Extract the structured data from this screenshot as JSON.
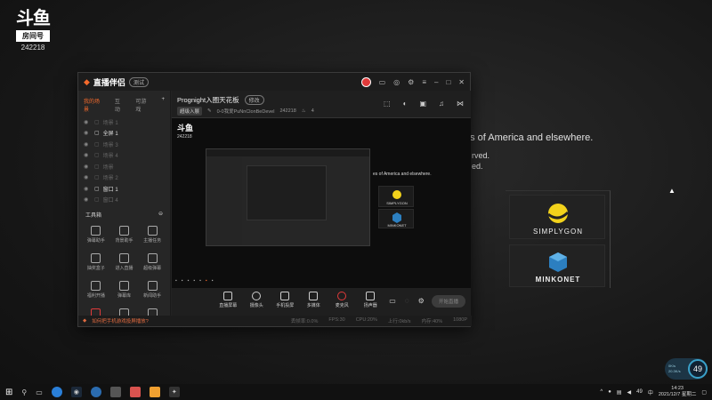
{
  "watermark": {
    "logo": "斗鱼",
    "room_label": "房间号",
    "room_id": "242218"
  },
  "bg": {
    "line1": "es of America and elsewhere.",
    "line2": "rved.",
    "line3": "ed.",
    "brand1": "SIMPLYGON",
    "brand2": "MINKONET"
  },
  "app": {
    "brand": "直播伴侣",
    "version_pill": "测试",
    "side_tabs": [
      "我的场景",
      "互动",
      "可游戏"
    ],
    "scenes": [
      {
        "label": "场景 1",
        "hi": false
      },
      {
        "label": "全屏 1",
        "hi": true
      },
      {
        "label": "场景 3",
        "hi": false
      },
      {
        "label": "场景 4",
        "hi": false
      },
      {
        "label": "场景",
        "hi": false
      },
      {
        "label": "场景 2",
        "hi": false
      },
      {
        "label": "窗口 1",
        "hi": true
      },
      {
        "label": "窗口 4",
        "hi": false
      }
    ],
    "tools_title": "工具箱",
    "tools": [
      "弹幕助手",
      "背景助手",
      "主播任务",
      "抽奖盒子",
      "进入直播",
      "超级弹幕",
      "福利开播",
      "弹幕库",
      "新闻助手",
      "",
      "",
      ""
    ],
    "room_title": "Prognight入圈天花板",
    "room_tag": "修改",
    "room_meta_tag": "超级入展",
    "room_meta_text": "0-0我爱PuNnClonBeDevel",
    "room_meta_id": "242218",
    "room_meta_count": "4",
    "preview_wm": "斗鱼",
    "preview_wm_id": "242218",
    "preview_text": "es of America and elsewhere.",
    "preview_brand1": "SIMPLYGON",
    "preview_brand2": "MINKONET",
    "bottom_buttons": [
      "直播屏幕",
      "摄像头",
      "手机投屏",
      "多媒体",
      "麦克风",
      "扬声器"
    ],
    "start_live": "开始直播",
    "status_msg": "如何把手机游戏投屏播放?",
    "status_stats": [
      "丢帧率:0.0%",
      "FPS:30",
      "CPU:20%",
      "上行:0kb/s",
      "内存:40%",
      "1080P"
    ]
  },
  "taskbar": {
    "time": "14:23",
    "date": "2021/12/7 星期二",
    "lang": "中",
    "volume_pct": "49"
  },
  "net_widget": {
    "up": "0K/s",
    "down": "20.3K/s",
    "pct": "49"
  }
}
